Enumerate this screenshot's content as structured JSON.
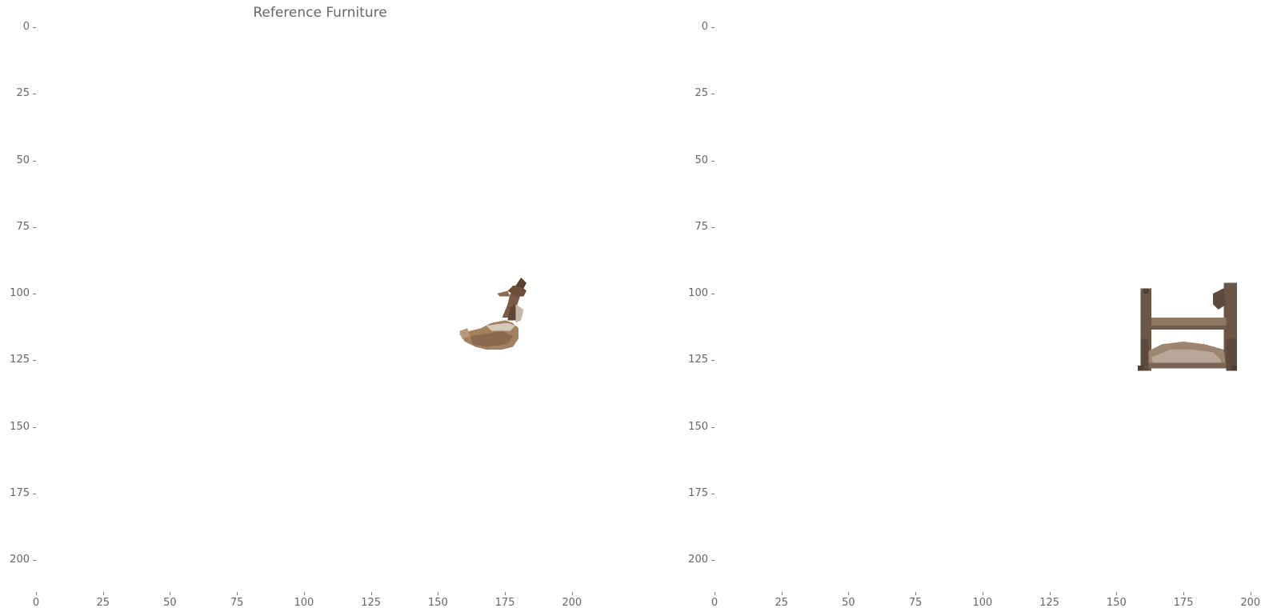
{
  "figure": {
    "title": "Reference Furniture"
  },
  "chart_data": [
    {
      "type": "image",
      "title": "Reference Furniture",
      "xlim": [
        0,
        212
      ],
      "ylim": [
        212,
        0
      ],
      "xticks": [
        "0",
        "25",
        "50",
        "75",
        "100",
        "125",
        "150",
        "175",
        "200"
      ],
      "yticks": [
        "0",
        "25",
        "50",
        "75",
        "100",
        "125",
        "150",
        "175",
        "200"
      ],
      "tick_values": [
        0,
        25,
        50,
        75,
        100,
        125,
        150,
        175,
        200
      ],
      "grid": false,
      "object": "duck-shaped wooden ornament",
      "object_colors": [
        "#8a6a4e",
        "#a4815e",
        "#6b4f3a",
        "#c8b7a6"
      ]
    },
    {
      "type": "image",
      "title": "",
      "xlim": [
        0,
        212
      ],
      "ylim": [
        212,
        0
      ],
      "xticks": [
        "0",
        "25",
        "50",
        "75",
        "100",
        "125",
        "150",
        "175",
        "200"
      ],
      "yticks": [
        "0",
        "25",
        "50",
        "75",
        "100",
        "125",
        "150",
        "175",
        "200"
      ],
      "tick_values": [
        0,
        25,
        50,
        75,
        100,
        125,
        150,
        175,
        200
      ],
      "grid": false,
      "object": "wooden bench / small bed frame",
      "object_colors": [
        "#7a6554",
        "#9e8570",
        "#5c4a3c",
        "#b8a797"
      ]
    }
  ]
}
